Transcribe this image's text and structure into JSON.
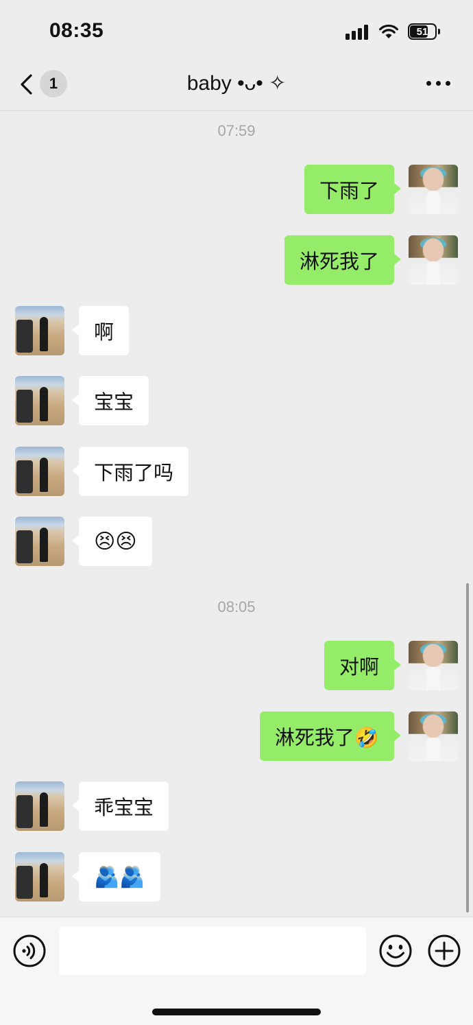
{
  "status_bar": {
    "time": "08:35",
    "battery": "51"
  },
  "header": {
    "back_icon": "chevron-left-icon",
    "unread_count": "1",
    "title": "baby •ᴗ• ✧",
    "more_icon": "ellipsis-icon"
  },
  "messages": [
    {
      "type": "time",
      "text": "07:59"
    },
    {
      "type": "msg",
      "from": "me",
      "text": "下雨了"
    },
    {
      "type": "msg",
      "from": "me",
      "text": "淋死我了"
    },
    {
      "type": "msg",
      "from": "them",
      "text": "啊"
    },
    {
      "type": "msg",
      "from": "them",
      "text": "宝宝"
    },
    {
      "type": "msg",
      "from": "them",
      "text": "下雨了吗"
    },
    {
      "type": "msg",
      "from": "them",
      "text": "😣😣"
    },
    {
      "type": "time",
      "text": "08:05"
    },
    {
      "type": "msg",
      "from": "me",
      "text": "对啊"
    },
    {
      "type": "msg",
      "from": "me",
      "text": "淋死我了🤣"
    },
    {
      "type": "msg",
      "from": "them",
      "text": "乖宝宝"
    },
    {
      "type": "msg",
      "from": "them",
      "text": "🫂🫂"
    }
  ],
  "input_bar": {
    "voice_icon": "voice-icon",
    "input_value": "",
    "emoji_icon": "smiley-icon",
    "plus_icon": "plus-circle-icon"
  },
  "colors": {
    "background": "#ededed",
    "my_bubble": "#95ec69",
    "their_bubble": "#ffffff",
    "timestamp": "#a6a6a6"
  }
}
